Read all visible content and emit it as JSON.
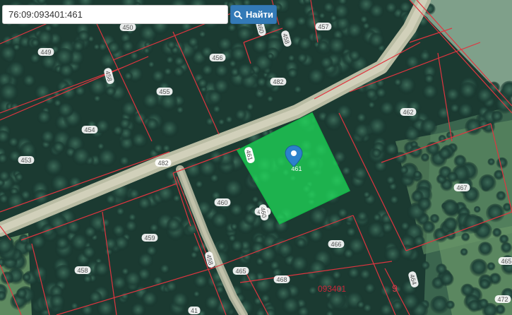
{
  "search": {
    "value": "76:09:093401:461",
    "button_label": "Найти",
    "button_icon": "search-icon"
  },
  "colors": {
    "boundary": "#e0353f",
    "selected_parcel": "#1fe05a",
    "search_button": "#337ab7",
    "marker": "#2b82cb"
  },
  "map": {
    "selected_parcel": "461",
    "parcels": [
      "450",
      "457",
      "449",
      "456",
      "458",
      "455",
      "482",
      "462",
      "454",
      "453",
      "482",
      "461",
      "467",
      "460",
      "440",
      "459",
      "466",
      "465",
      "468",
      "465",
      "093401",
      "9",
      "461",
      "472",
      "41"
    ],
    "rotated_labels": [
      "460",
      "458",
      "458",
      "455",
      "461",
      "460",
      "458",
      "464",
      "461"
    ]
  }
}
